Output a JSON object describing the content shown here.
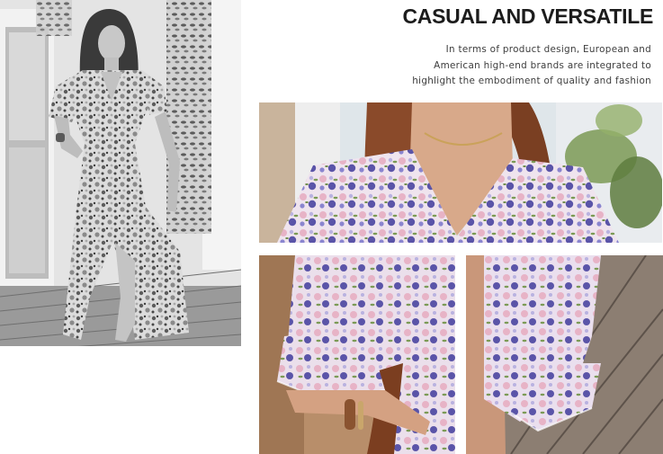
{
  "headline": "CASUAL AND VERSATILE",
  "description": "In terms of product design, European and American high-end brands are integrated to highlight the embodiment of quality and fashion",
  "description_lines": [
    "In terms of product design, European and",
    "American high-end brands are integrated to",
    "highlight the embodiment of quality and fashion"
  ],
  "colors": {
    "background": "#ffffff",
    "headline_text": "#1c1c1c",
    "body_text": "#3d3d3d",
    "floral_pink": "#e7b3c6",
    "floral_purple": "#5a54a8",
    "floral_lavender": "#b9b2e0",
    "foliage_green": "#7b9a55"
  }
}
